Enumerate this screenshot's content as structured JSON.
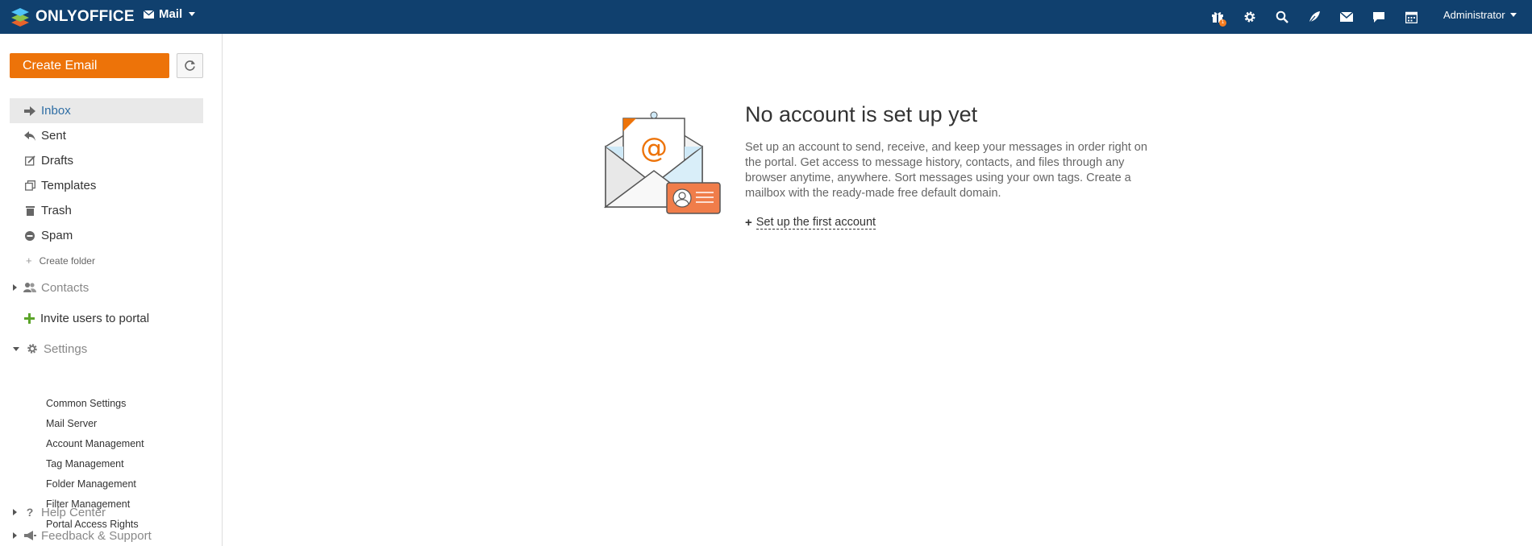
{
  "topbar": {
    "brand": "ONLYOFFICE",
    "module": "Mail",
    "icons": [
      "gift-icon",
      "gear-icon",
      "search-icon",
      "feed-icon",
      "mail-icon",
      "chat-icon",
      "calendar-icon"
    ],
    "gift_badge": "1",
    "user": "Administrator",
    "colors": {
      "bar": "#10406e",
      "badge": "#f47c20"
    }
  },
  "sidebar": {
    "create_button": "Create Email",
    "folders": [
      {
        "label": "Inbox",
        "icon": "inbox-arrow-icon",
        "active": true
      },
      {
        "label": "Sent",
        "icon": "reply-arrow-icon"
      },
      {
        "label": "Drafts",
        "icon": "draft-edit-icon"
      },
      {
        "label": "Templates",
        "icon": "templates-icon"
      },
      {
        "label": "Trash",
        "icon": "trash-icon"
      },
      {
        "label": "Spam",
        "icon": "spam-icon"
      }
    ],
    "create_folder": "Create folder",
    "contacts": "Contacts",
    "invite": "Invite users to portal",
    "settings": "Settings",
    "settings_items": [
      "Common Settings",
      "Mail Server",
      "Account Management",
      "Tag Management",
      "Folder Management",
      "Filter Management",
      "Portal Access Rights"
    ],
    "help": "Help Center",
    "feedback": "Feedback & Support",
    "colors": {
      "create_button": "#ed7309",
      "active_text": "#2e6da4",
      "invite_plus": "#5ba429"
    }
  },
  "main": {
    "title": "No account is set up yet",
    "description": "Set up an account to send, receive, and keep your messages in order right on the portal. Get access to message history, contacts, and files through any browser anytime, anywhere. Sort messages using your own tags. Create a mailbox with the ready-made free default domain.",
    "setup_link": "Set up the first account"
  }
}
